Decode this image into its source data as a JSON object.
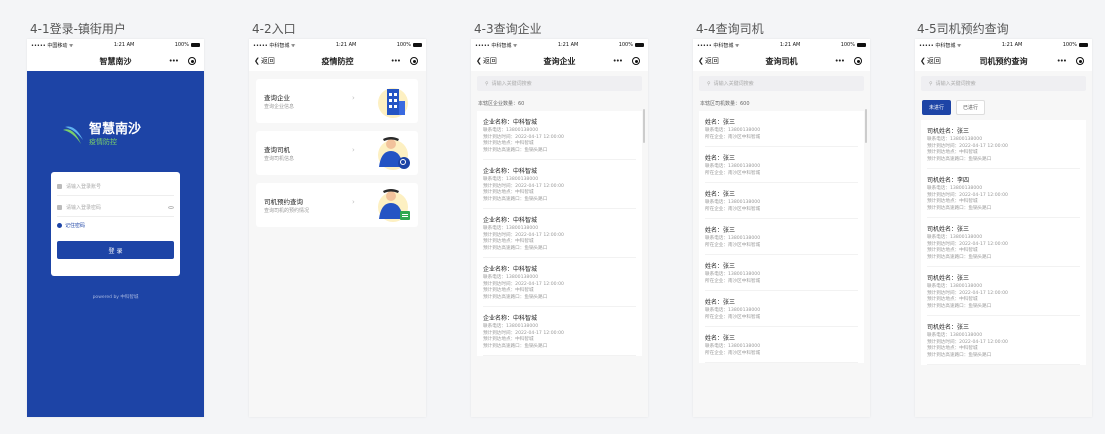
{
  "screens": [
    {
      "title": "4-1登录-镇街用户"
    },
    {
      "title": "4-2入口"
    },
    {
      "title": "4-3查询企业"
    },
    {
      "title": "4-4查询司机"
    },
    {
      "title": "4-5司机预约查询"
    }
  ],
  "status": {
    "carrier": "••••• 中国移动 ᯤ",
    "carrier2": "••••• 中科智城 ᯤ",
    "time": "1:21 AM",
    "battery": "100%"
  },
  "login": {
    "nav_title": "智慧南沙",
    "logo_title": "智慧南沙",
    "logo_sub": "疫情防控",
    "account_placeholder": "请输入登录账号",
    "password_placeholder": "请输入登录密码",
    "remember": "记住密码",
    "button": "登 录",
    "powered": "powered by 中科智城"
  },
  "entry": {
    "nav_title": "疫情防控",
    "back": "返回",
    "cards": [
      {
        "title": "查询企业",
        "sub": "查询企业信息"
      },
      {
        "title": "查询司机",
        "sub": "查询司机信息"
      },
      {
        "title": "司机预约查询",
        "sub": "查询司机的预约情况"
      }
    ]
  },
  "company": {
    "nav_title": "查询企业",
    "back": "返回",
    "search_placeholder": "请输入关键词搜索",
    "count": "本辖区企业数量：60",
    "items": [
      {
        "title": "企业名称：中科智城",
        "lines": [
          "联系电话：13800138000",
          "预计到达时间：2022-04-17 12:00:00",
          "预计到达地点：中科智城",
          "预计到达高速路口：鱼锅头路口"
        ]
      },
      {
        "title": "企业名称：中科智城",
        "lines": [
          "联系电话：13800138000",
          "预计到达时间：2022-04-17 12:00:00",
          "预计到达地点：中科智城",
          "预计到达高速路口：鱼锅头路口"
        ]
      },
      {
        "title": "企业名称：中科智城",
        "lines": [
          "联系电话：13800138000",
          "预计到达时间：2022-04-17 12:00:00",
          "预计到达地点：中科智城",
          "预计到达高速路口：鱼锅头路口"
        ]
      },
      {
        "title": "企业名称：中科智城",
        "lines": [
          "联系电话：13800138000",
          "预计到达时间：2022-04-17 12:00:00",
          "预计到达地点：中科智城",
          "预计到达高速路口：鱼锅头路口"
        ]
      },
      {
        "title": "企业名称：中科智城",
        "lines": [
          "联系电话：13800138000",
          "预计到达时间：2022-04-17 12:00:00",
          "预计到达地点：中科智城",
          "预计到达高速路口：鱼锅头路口"
        ]
      }
    ]
  },
  "driver": {
    "nav_title": "查询司机",
    "back": "返回",
    "search_placeholder": "请输入关键词搜索",
    "count": "本辖区司机数量：600",
    "items": [
      {
        "title": "姓名：张三",
        "lines": [
          "联系电话：13800138000",
          "所在企业：南沙区中科智城"
        ]
      },
      {
        "title": "姓名：张三",
        "lines": [
          "联系电话：13800138000",
          "所在企业：南沙区中科智城"
        ]
      },
      {
        "title": "姓名：张三",
        "lines": [
          "联系电话：13800138000",
          "所在企业：南沙区中科智城"
        ]
      },
      {
        "title": "姓名：张三",
        "lines": [
          "联系电话：13800138000",
          "所在企业：南沙区中科智城"
        ]
      },
      {
        "title": "姓名：张三",
        "lines": [
          "联系电话：13800138000",
          "所在企业：南沙区中科智城"
        ]
      },
      {
        "title": "姓名：张三",
        "lines": [
          "联系电话：13800138000",
          "所在企业：南沙区中科智城"
        ]
      },
      {
        "title": "姓名：张三",
        "lines": [
          "联系电话：13800138000",
          "所在企业：南沙区中科智城"
        ]
      }
    ]
  },
  "reservation": {
    "nav_title": "司机预约查询",
    "back": "返回",
    "search_placeholder": "请输入关键词搜索",
    "tabs": [
      "未进行",
      "已进行"
    ],
    "items": [
      {
        "title": "司机姓名：张三",
        "lines": [
          "联系电话：13800138000",
          "预计到达时间：2022-04-17 12:00:00",
          "预计到达地点：中科智城",
          "预计到达高速路口：鱼锅头路口"
        ]
      },
      {
        "title": "司机姓名：李四",
        "lines": [
          "联系电话：13800138000",
          "预计到达时间：2022-04-17 12:00:00",
          "预计到达地点：中科智城",
          "预计到达高速路口：鱼锅头路口"
        ]
      },
      {
        "title": "司机姓名：张三",
        "lines": [
          "联系电话：13800138000",
          "预计到达时间：2022-04-17 12:00:00",
          "预计到达地点：中科智城",
          "预计到达高速路口：鱼锅头路口"
        ]
      },
      {
        "title": "司机姓名：张三",
        "lines": [
          "联系电话：13800138000",
          "预计到达时间：2022-04-17 12:00:00",
          "预计到达地点：中科智城",
          "预计到达高速路口：鱼锅头路口"
        ]
      },
      {
        "title": "司机姓名：张三",
        "lines": [
          "联系电话：13800138000",
          "预计到达时间：2022-04-17 12:00:00",
          "预计到达地点：中科智城",
          "预计到达高速路口：鱼锅头路口"
        ]
      }
    ]
  },
  "colors": {
    "brand": "#1d44a6",
    "green": "#7ad06a"
  }
}
